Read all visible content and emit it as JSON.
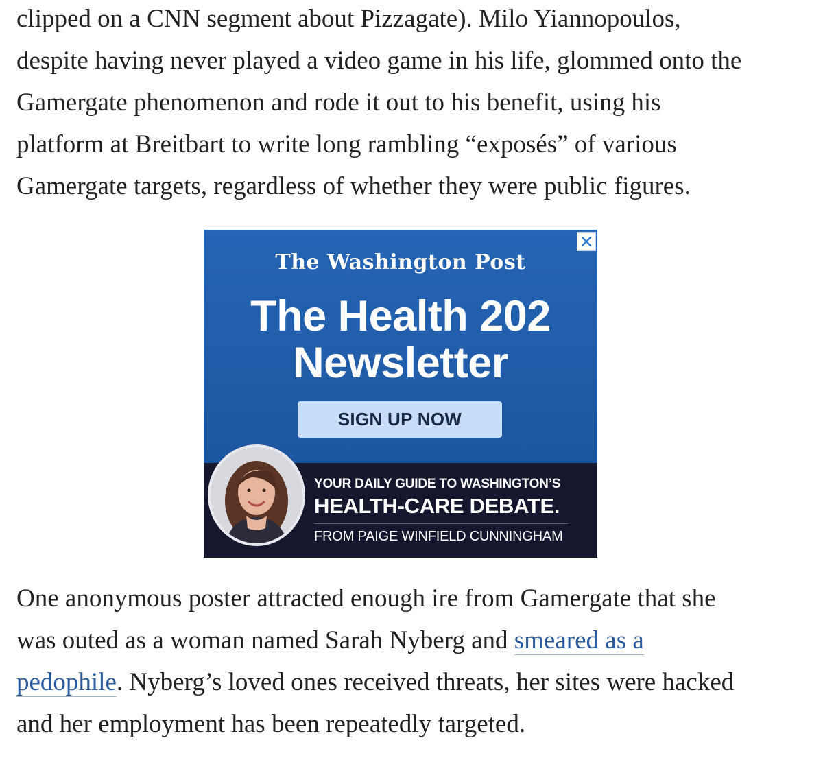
{
  "article": {
    "para1_lines": [
      "clipped on a CNN segment about Pizzagate). Milo Yiannopoulos,",
      "despite having never played a video game in his life, glommed onto the",
      "Gamergate phenomenon and rode it out to his benefit, using his",
      "platform at Breitbart to write long rambling “exposés” of various",
      "Gamergate targets, regardless of whether they were public figures."
    ],
    "para2": {
      "line1": "One anonymous poster attracted enough ire from Gamergate that she",
      "line2_text": "was outed as a woman named Sarah Nyberg and ",
      "link_part1": "smeared as a",
      "link_part2": "pedophile",
      "line3_text": ". Nyberg’s loved ones received threats, her sites were hacked",
      "line4": "and her employment has been repeatedly targeted."
    }
  },
  "ad": {
    "logo": "The Washington Post",
    "title_line1": "The Health 202",
    "title_line2": "Newsletter",
    "button": "SIGN UP NOW",
    "sub1": "YOUR DAILY GUIDE TO WASHINGTON’S",
    "sub2": "HEALTH-CARE DEBATE.",
    "sub3": "FROM PAIGE WINFIELD CUNNINGHAM",
    "close_icon": "close-icon",
    "colors": {
      "ad_blue": "#2565b5",
      "ad_dark": "#15172e",
      "button_bg": "#c8ddf7",
      "link": "#2a5b9e"
    }
  }
}
